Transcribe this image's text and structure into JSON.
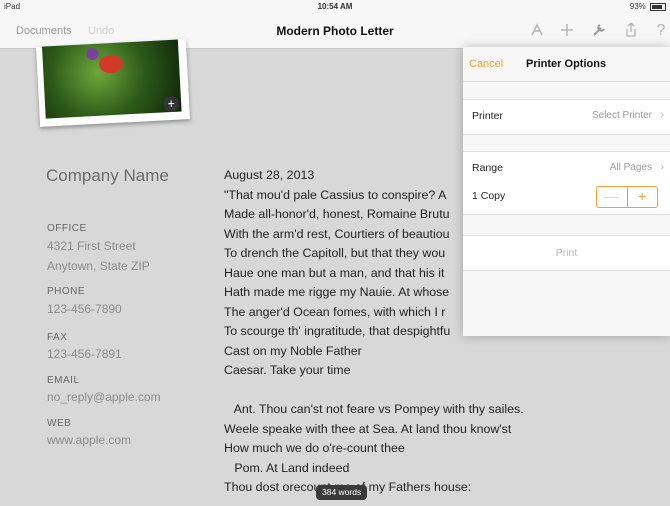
{
  "status": {
    "device": "iPad",
    "time": "10:54 AM",
    "battery": "93%"
  },
  "toolbar": {
    "documents": "Documents",
    "undo": "Undo",
    "title": "Modern Photo Letter"
  },
  "sidebar": {
    "company": "Company Name",
    "sections": [
      {
        "label": "OFFICE",
        "lines": [
          "4321 First Street",
          "Anytown, State ZIP"
        ]
      },
      {
        "label": "PHONE",
        "lines": [
          "123-456-7890"
        ]
      },
      {
        "label": "FAX",
        "lines": [
          "123-456-7891"
        ]
      },
      {
        "label": "EMAIL",
        "lines": [
          "no_reply@apple.com"
        ]
      },
      {
        "label": "WEB",
        "lines": [
          "www.apple.com"
        ]
      }
    ]
  },
  "body": {
    "lines": [
      "August 28, 2013",
      "\"That mou'd pale Cassius to conspire? A",
      "Made all-honor'd, honest, Romaine Brutu",
      "With the arm'd rest, Courtiers of beautiou",
      "To drench the Capitoll, but that they wou",
      "Haue one man but a man, and that his it",
      "Hath made me rigge my Nauie. At whose",
      "The anger'd Ocean fomes, with which I r",
      "To scourge th' ingratitude, that despightfu",
      "Cast on my Noble Father",
      "Caesar. Take your time",
      "",
      "   Ant. Thou can'st not feare vs Pompey with thy sailes.",
      "Weele speake with thee at Sea. At land thou know'st",
      "How much we do o're-count thee",
      "   Pom. At Land indeed",
      "Thou dost orecount me of my Fathers house:"
    ]
  },
  "word_count": "384 words",
  "printer_options": {
    "cancel": "Cancel",
    "title": "Printer Options",
    "printer_label": "Printer",
    "printer_value": "Select Printer",
    "range_label": "Range",
    "range_value": "All Pages",
    "copies_label": "1 Copy",
    "minus": "—",
    "plus": "+",
    "print": "Print"
  },
  "colors": {
    "accent": "#f0a030",
    "background": "#d8d8d8"
  }
}
